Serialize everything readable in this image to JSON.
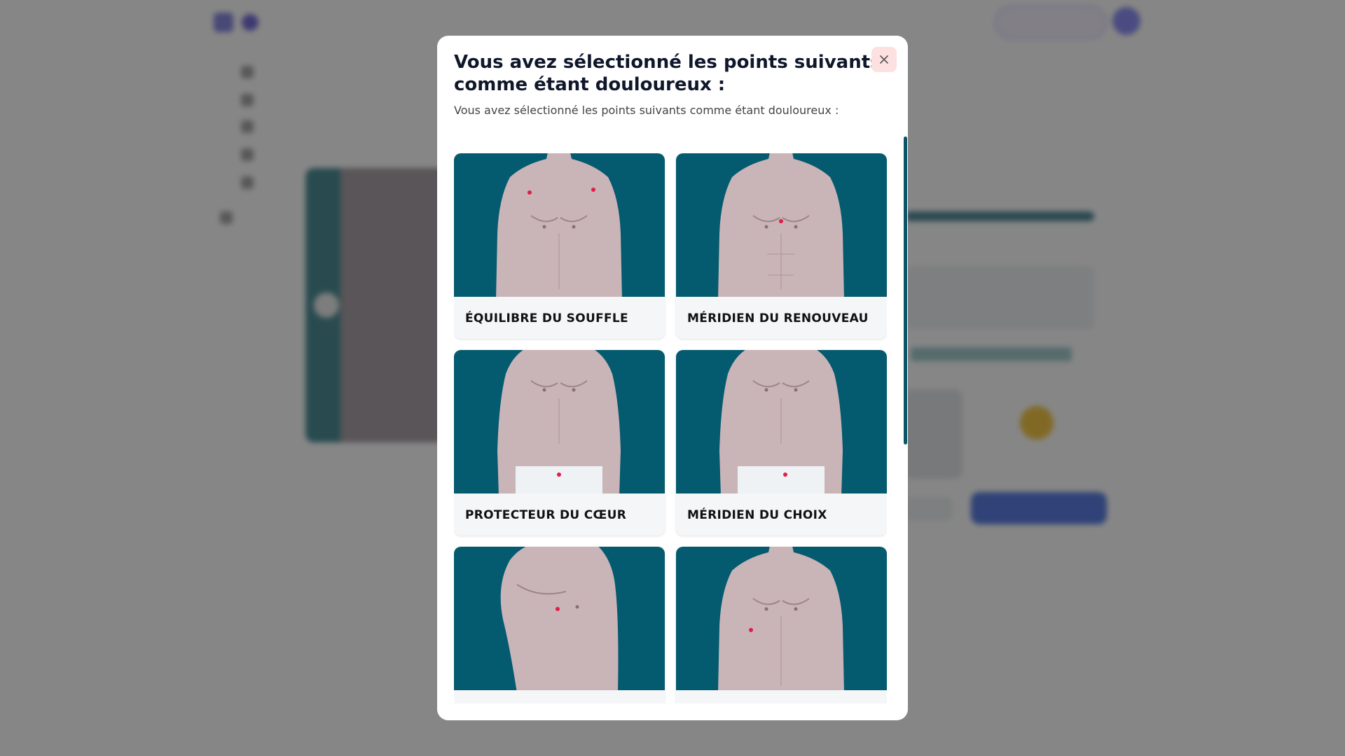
{
  "modal": {
    "title": "Vous avez sélectionné les points suivants comme étant douloureux :",
    "subtitle": "Vous avez sélectionné les points suivants comme étant douloureux :",
    "close_icon": "close-icon",
    "points": [
      {
        "label": "ÉQUILIBRE DU SOUFFLE",
        "has_briefs": false
      },
      {
        "label": "MÉRIDIEN DU RENOUVEAU",
        "has_briefs": false
      },
      {
        "label": "PROTECTEUR DU CŒUR",
        "has_briefs": true
      },
      {
        "label": "MÉRIDIEN DU CHOIX",
        "has_briefs": true
      },
      {
        "label": "",
        "has_briefs": false
      },
      {
        "label": "",
        "has_briefs": false
      }
    ]
  },
  "colors": {
    "image_bg": "#045a6e",
    "point_marker": "#e11d48",
    "close_bg": "#fde0e0",
    "scrollbar": "#0b5567"
  }
}
